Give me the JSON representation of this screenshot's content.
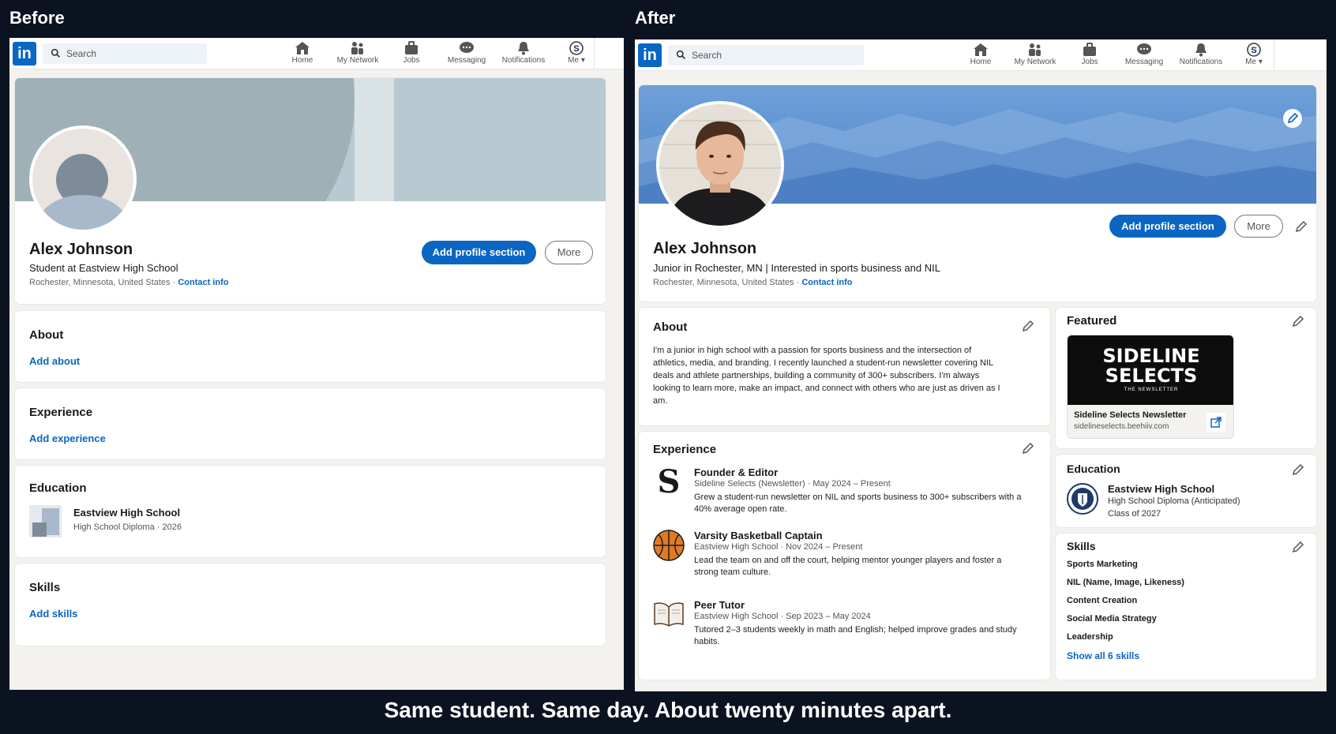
{
  "labels": {
    "before": "Before",
    "after": "After"
  },
  "caption": "Same student. Same day. About twenty minutes apart.",
  "nav": {
    "search_placeholder": "Search",
    "items": [
      "Home",
      "My Network",
      "Jobs",
      "Messaging",
      "Notifications",
      "Me"
    ],
    "logo": "in"
  },
  "before": {
    "name": "Alex Johnson",
    "headline": "Student at Eastview High School",
    "location": "Rochester, Minnesota, United States",
    "dot": "·",
    "contact": "Contact info",
    "add_section": "Add profile section",
    "more": "More",
    "about": {
      "title": "About",
      "action": "Add about"
    },
    "experience": {
      "title": "Experience",
      "action": "Add experience"
    },
    "education": {
      "title": "Education",
      "school": "Eastview High School",
      "detail": "High School Diploma · 2026"
    },
    "skills": {
      "title": "Skills",
      "action": "Add skills"
    }
  },
  "after": {
    "name": "Alex Johnson",
    "headline": "Junior in Rochester, MN | Interested in sports business and NIL",
    "location": "Rochester, Minnesota, United States",
    "dot": "·",
    "contact": "Contact info",
    "add_section": "Add profile section",
    "more": "More",
    "about": {
      "title": "About",
      "text": "I'm a junior in high school with a passion for sports business and the intersection of athletics, media, and branding. I recently launched a student-run newsletter covering NIL deals and athlete partnerships, building a community of 300+ subscribers. I'm always looking to learn more, make an impact, and connect with others who are just as driven as I am."
    },
    "experience": {
      "title": "Experience",
      "items": [
        {
          "title": "Founder & Editor",
          "sub": "Sideline Selects (Newsletter) · May 2024 – Present",
          "desc": "Grew a student-run newsletter on NIL and sports business to 300+ subscribers with a 40% average open rate.",
          "icon": "s-logo-icon"
        },
        {
          "title": "Varsity Basketball Captain",
          "sub": "Eastview High School · Nov 2024 – Present",
          "desc": "Lead the team on and off the court, helping mentor younger players and foster a strong team culture.",
          "icon": "basketball-icon"
        },
        {
          "title": "Peer Tutor",
          "sub": "Eastview High School · Sep 2023 – May 2024",
          "desc": "Tutored 2–3 students weekly in math and English; helped improve grades and study habits.",
          "icon": "book-icon"
        }
      ]
    },
    "featured": {
      "title": "Featured",
      "image_line1": "SIDELINE",
      "image_line2": "SELECTS",
      "image_tag": "THE NEWSLETTER",
      "item_title": "Sideline Selects Newsletter",
      "item_url": "sidelineselects.beehiiv.com"
    },
    "education": {
      "title": "Education",
      "school": "Eastview High School",
      "degree": "High School Diploma (Anticipated)",
      "class": "Class of 2027"
    },
    "skills": {
      "title": "Skills",
      "items": [
        "Sports Marketing",
        "NIL (Name, Image, Likeness)",
        "Content Creation",
        "Social Media Strategy",
        "Leadership"
      ],
      "show_all": "Show all 6 skills"
    }
  },
  "colors": {
    "brand": "#0a66c2",
    "bg": "#0b1220",
    "page": "#f3f2ef"
  }
}
